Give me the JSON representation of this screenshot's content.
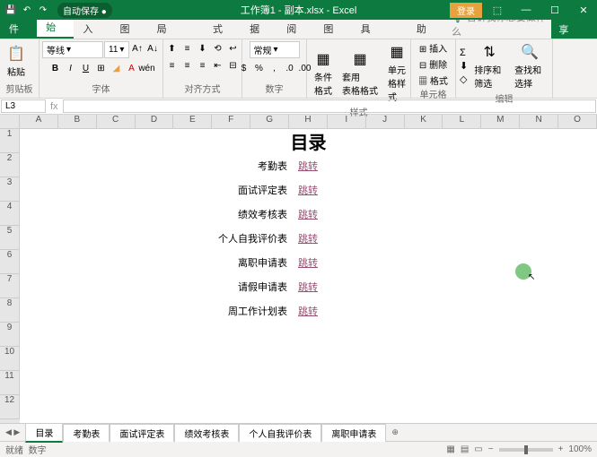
{
  "titlebar": {
    "autosave": "自动保存",
    "title": "工作簿1 - 副本.xlsx - Excel",
    "login": "登录"
  },
  "tabs": {
    "items": [
      "文件",
      "开始",
      "插入",
      "绘图",
      "页面布局",
      "公式",
      "数据",
      "审阅",
      "视图",
      "开发工具",
      "帮助"
    ],
    "active": 1,
    "tell": "告诉我你想要做什么",
    "share": "共享"
  },
  "ribbon": {
    "clipboard": {
      "paste": "粘贴",
      "label": "剪贴板"
    },
    "font": {
      "name": "等线",
      "size": "11",
      "label": "字体"
    },
    "align": {
      "label": "对齐方式"
    },
    "number": {
      "format": "常规",
      "label": "数字"
    },
    "styles": {
      "cond": "条件格式",
      "table": "套用\n表格格式",
      "cell": "单元格样式",
      "label": "样式"
    },
    "cells": {
      "insert": "插入",
      "delete": "删除",
      "format": "格式",
      "label": "单元格"
    },
    "editing": {
      "sort": "排序和筛选",
      "find": "查找和选择",
      "label": "编辑"
    }
  },
  "namebox": {
    "ref": "L3"
  },
  "columns": [
    "A",
    "B",
    "C",
    "D",
    "E",
    "F",
    "G",
    "H",
    "I",
    "J",
    "K",
    "L",
    "M",
    "N",
    "O"
  ],
  "rows": [
    "1",
    "2",
    "3",
    "4",
    "5",
    "6",
    "7",
    "8",
    "9",
    "10",
    "11",
    "12"
  ],
  "content": {
    "title": "目录",
    "items": [
      {
        "label": "考勤表",
        "link": "跳转"
      },
      {
        "label": "面试评定表",
        "link": "跳转"
      },
      {
        "label": "绩效考核表",
        "link": "跳转"
      },
      {
        "label": "个人自我评价表",
        "link": "跳转"
      },
      {
        "label": "离职申请表",
        "link": "跳转"
      },
      {
        "label": "请假申请表",
        "link": "跳转"
      },
      {
        "label": "周工作计划表",
        "link": "跳转"
      }
    ]
  },
  "sheets": {
    "items": [
      "目录",
      "考勤表",
      "面试评定表",
      "绩效考核表",
      "个人自我评价表",
      "离职申请表"
    ],
    "active": 0
  },
  "status": {
    "ready": "就绪",
    "mode": "数字",
    "zoom": "100%"
  }
}
